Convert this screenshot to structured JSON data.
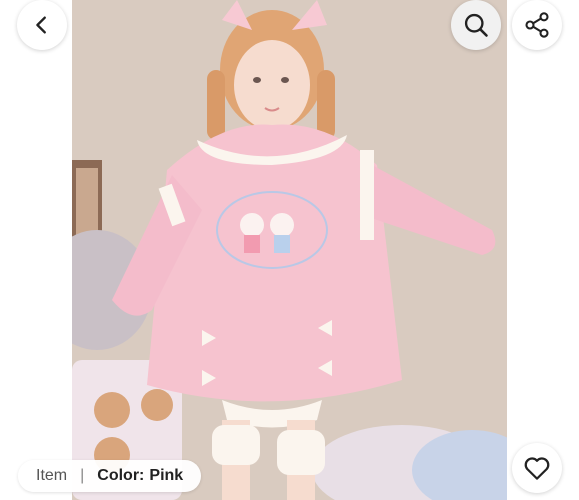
{
  "toolbar": {
    "back_icon": "chevron-left-icon",
    "search_icon": "search-icon",
    "share_icon": "share-icon"
  },
  "product_image": {
    "description_icon": "product-photo"
  },
  "variant_chip": {
    "item_label": "Item",
    "separator": "|",
    "color_label": "Color:",
    "color_value": "Pink"
  },
  "favorite": {
    "icon": "heart-outline-icon"
  },
  "colors": {
    "sweater": "#f6c3cf",
    "lace": "#fbf5ee",
    "background": "#d8cabe"
  }
}
